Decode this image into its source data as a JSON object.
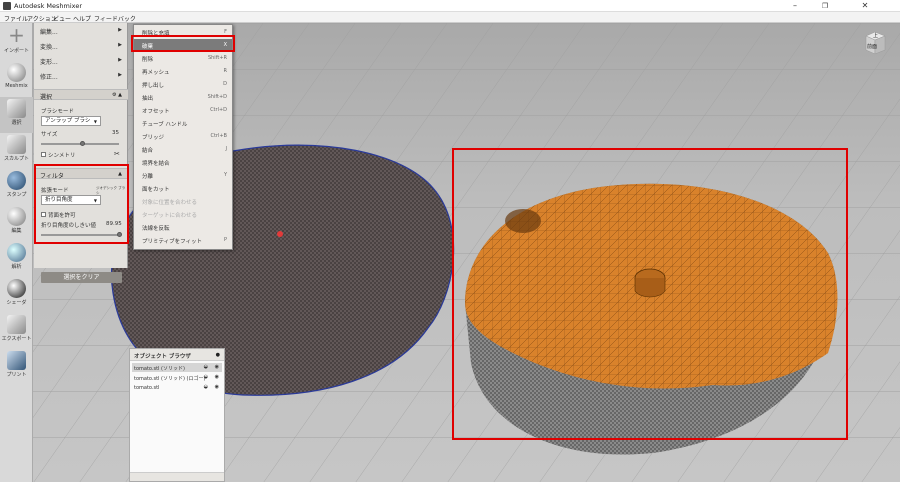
{
  "window": {
    "title": "Autodesk Meshmixer",
    "minimize": "–",
    "maximize": "❐",
    "close": "✕"
  },
  "menubar": [
    "ファイル",
    "アクション",
    "ビュー",
    "ヘルプ",
    "フィードバック"
  ],
  "toolbar": [
    {
      "label": "インポート",
      "icon": "plus-icon"
    },
    {
      "label": "Meshmix",
      "icon": "meshmix-icon"
    },
    {
      "label": "選択",
      "icon": "select-icon"
    },
    {
      "label": "スカルプト",
      "icon": "sculpt-icon"
    },
    {
      "label": "スタンプ",
      "icon": "stamp-icon"
    },
    {
      "label": "編集",
      "icon": "edit-icon"
    },
    {
      "label": "解析",
      "icon": "analysis-icon"
    },
    {
      "label": "シェーダ",
      "icon": "shader-icon"
    },
    {
      "label": "エクスポート",
      "icon": "export-icon"
    },
    {
      "label": "プリント",
      "icon": "print-icon"
    }
  ],
  "panel": {
    "top_items": [
      "編集...",
      "変換...",
      "変形...",
      "修正..."
    ],
    "select_section": {
      "title": "選択",
      "brush_mode_label": "ブラシモード",
      "brush_mode_value": "アンラップ ブラシ",
      "size_label": "サイズ",
      "size_value": "35",
      "symmetry_label": "シンメトリ"
    },
    "filter_section": {
      "title": "フィルタ",
      "expand_mode_label": "拡張モード",
      "geodesic_label": "ジオデシック ブラシ",
      "expand_mode_value": "折り目角度",
      "allow_back_label": "背面を許可",
      "threshold_label": "折り目角度のしきい値",
      "threshold_value": "89.95"
    },
    "clear_button": "選択をクリア"
  },
  "menu": [
    {
      "label": "削除と充填",
      "key": "F"
    },
    {
      "label": "破棄",
      "key": "X",
      "highlight": true
    },
    {
      "label": "削除",
      "key": "Shift+R"
    },
    {
      "label": "再メッシュ",
      "key": "R"
    },
    {
      "label": "押し出し",
      "key": "D"
    },
    {
      "label": "抽出",
      "key": "Shift+D"
    },
    {
      "label": "オフセット",
      "key": "Ctrl+D"
    },
    {
      "label": "チューブ ハンドル",
      "key": ""
    },
    {
      "label": "ブリッジ",
      "key": "Ctrl+B"
    },
    {
      "label": "結合",
      "key": "J"
    },
    {
      "label": "境界を結合",
      "key": ""
    },
    {
      "label": "分離",
      "key": "Y"
    },
    {
      "label": "面をカット",
      "key": ""
    },
    {
      "label": "対象に位置を合わせる",
      "key": "",
      "disabled": true
    },
    {
      "label": "ターゲットに合わせる",
      "key": "",
      "disabled": true
    },
    {
      "label": "法線を反転",
      "key": ""
    },
    {
      "label": "プリミティブをフィット",
      "key": "P"
    }
  ],
  "browser": {
    "title": "オブジェクト ブラウザ",
    "items": [
      {
        "label": "tomato.stl (ソリッド)",
        "selected": true
      },
      {
        "label": "tomato.stl (ソリッド) (ロゴー)",
        "selected": false
      },
      {
        "label": "tomato.stl",
        "selected": false
      }
    ]
  },
  "navcube": {
    "top": "上",
    "front": "前面"
  },
  "colors": {
    "highlight": "#7b7b7b",
    "accent_red": "#e00000",
    "mesh_orange": "#d9822b"
  }
}
